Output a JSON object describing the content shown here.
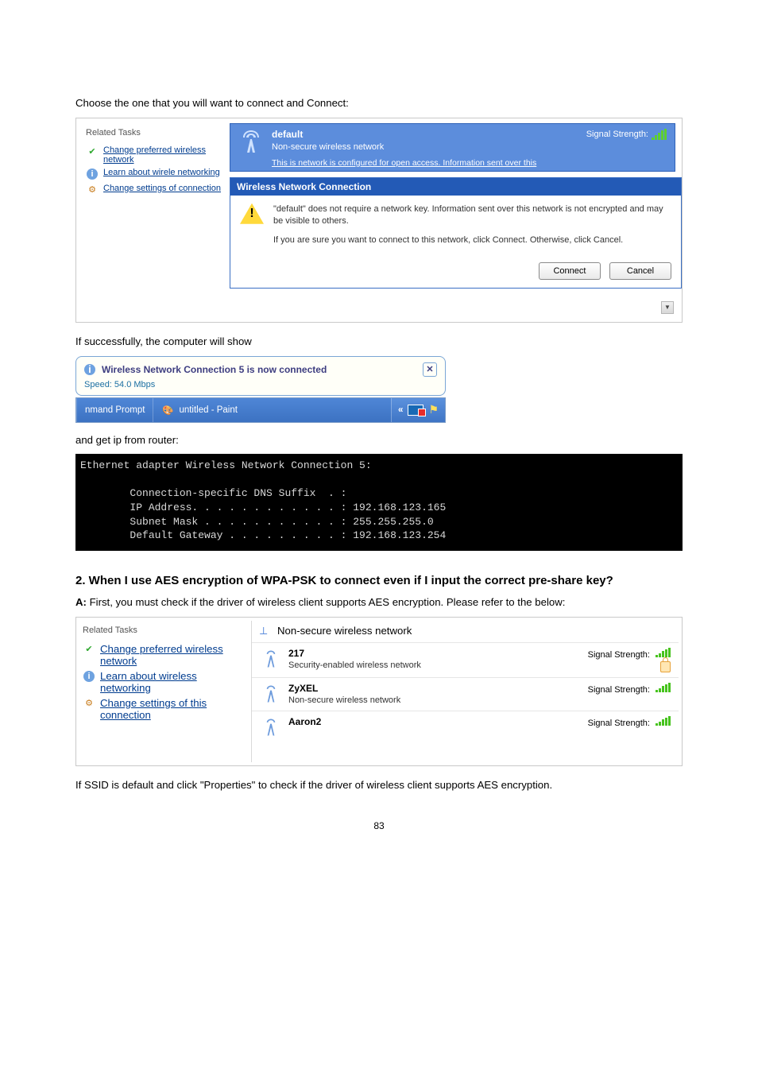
{
  "intro_line": "Choose the one that you will want to connect and Connect:",
  "wzc1": {
    "related_tasks_label": "Related Tasks",
    "link_pref_net": "Change preferred wireless network",
    "link_learn": "Learn about wirele networking",
    "link_settings": "Change settings of connection",
    "net": {
      "ssid": "default",
      "sub": "Non-secure wireless network",
      "sig_label": "Signal Strength:",
      "foot": "This is network is configured for open access. Information sent over this"
    },
    "dialog": {
      "title": "Wireless Network Connection",
      "msg1": "\"default\" does not require a network key. Information sent over this network is not encrypted and may be visible to others.",
      "msg2": "If you are sure you want to connect to this network, click Connect. Otherwise, click Cancel.",
      "btn_connect": "Connect",
      "btn_cancel": "Cancel"
    }
  },
  "line_success": "If successfully, the computer will show",
  "balloon": {
    "title": "Wireless Network Connection 5 is now connected",
    "speed": "Speed: 54.0 Mbps",
    "task1": "nmand Prompt",
    "task2": "untitled - Paint"
  },
  "line_getip": "and get ip from router:",
  "cmd": "Ethernet adapter Wireless Network Connection 5:\n\n        Connection-specific DNS Suffix  . :\n        IP Address. . . . . . . . . . . . : 192.168.123.165\n        Subnet Mask . . . . . . . . . . . : 255.255.255.0\n        Default Gateway . . . . . . . . . : 192.168.123.254",
  "sec2_heading": "2. When I use AES encryption of WPA-PSK to connect even if I input the correct pre-share key?",
  "sec2_a_label": "A:",
  "sec2_a_text": " First, you must check if the driver of wireless client supports AES encryption. Please refer to the below:",
  "wzc4": {
    "related_tasks_label": "Related Tasks",
    "link_pref_net": "Change preferred wireless network",
    "link_learn": "Learn about wireless networking",
    "link_settings": "Change settings of this connection",
    "top_nonsec": "Non-secure wireless network",
    "sig_label": "Signal Strength:",
    "items": [
      {
        "ssid": "217",
        "sub": "Security-enabled wireless network",
        "locked": true
      },
      {
        "ssid": "ZyXEL",
        "sub": "Non-secure wireless network",
        "locked": false
      },
      {
        "ssid": "Aaron2",
        "sub": "",
        "locked": false
      }
    ]
  },
  "closing_line": "If SSID is default and click \"Properties\" to check if the driver of wireless client supports AES encryption.",
  "page_number": "83"
}
